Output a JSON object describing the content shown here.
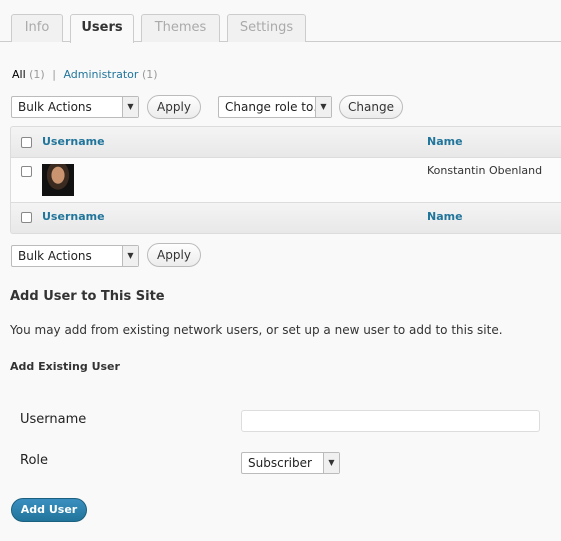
{
  "tabs": [
    {
      "label": "Info",
      "active": false
    },
    {
      "label": "Users",
      "active": true
    },
    {
      "label": "Themes",
      "active": false
    },
    {
      "label": "Settings",
      "active": false
    }
  ],
  "filters": {
    "all_label": "All",
    "all_count": "(1)",
    "separator": "|",
    "admin_label": "Administrator",
    "admin_count": "(1)"
  },
  "top_actions": {
    "bulk_select": "Bulk Actions",
    "apply_label": "Apply",
    "role_select": "Change role to…",
    "change_label": "Change"
  },
  "table": {
    "columns": [
      "Username",
      "Name"
    ],
    "rows": [
      {
        "username": "",
        "name": "Konstantin Obenland"
      }
    ]
  },
  "bottom_actions": {
    "bulk_select": "Bulk Actions",
    "apply_label": "Apply"
  },
  "add_user": {
    "heading": "Add User to This Site",
    "description": "You may add from existing network users, or set up a new user to add to this site.",
    "subheading": "Add Existing User",
    "username_label": "Username",
    "username_value": "",
    "role_label": "Role",
    "role_value": "Subscriber",
    "submit_label": "Add User"
  },
  "colors": {
    "link": "#21759b",
    "primary_button": "#21759b"
  }
}
